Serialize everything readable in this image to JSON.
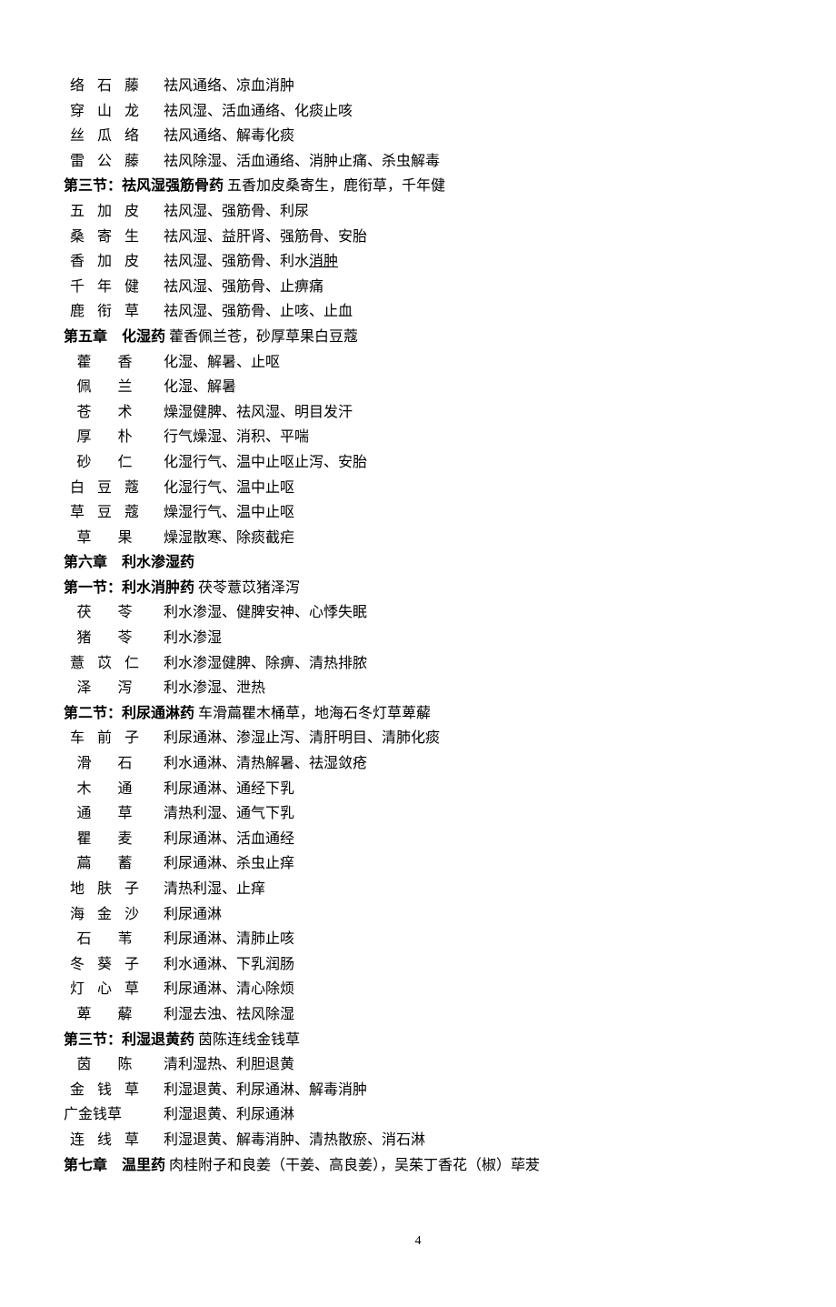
{
  "rows": [
    {
      "type": "item",
      "name": "络石藤",
      "desc": "祛风通络、凉血消肿"
    },
    {
      "type": "item",
      "name": "穿山龙",
      "desc": "祛风湿、活血通络、化痰止咳"
    },
    {
      "type": "item",
      "name": "丝瓜络",
      "desc": "祛风通络、解毒化痰"
    },
    {
      "type": "item",
      "name": "雷公藤",
      "desc": "祛风除湿、活血通络、消肿止痛、杀虫解毒"
    },
    {
      "type": "hdr",
      "bold": "第三节：祛风湿强筋骨药",
      "rest": " 五香加皮桑寄生，鹿衔草，千年健"
    },
    {
      "type": "item",
      "name": "五加皮",
      "desc": "祛风湿、强筋骨、利尿"
    },
    {
      "type": "item",
      "name": "桑寄生",
      "desc": "祛风湿、益肝肾、强筋骨、安胎"
    },
    {
      "type": "item",
      "name": "香加皮",
      "desc_pre": "祛风湿、强筋骨、利水",
      "desc_u": "消肿"
    },
    {
      "type": "item",
      "name": "千年健",
      "desc": "祛风湿、强筋骨、止痹痛"
    },
    {
      "type": "item",
      "name": "鹿衔草",
      "desc": "祛风湿、强筋骨、止咳、止血"
    },
    {
      "type": "hdr",
      "bold": "第五章　化湿药",
      "rest": " 藿香佩兰苍，砂厚草果白豆蔻"
    },
    {
      "type": "item",
      "name": "藿香",
      "desc": "化湿、解暑、止呕"
    },
    {
      "type": "item",
      "name": "佩兰",
      "desc": "化湿、解暑"
    },
    {
      "type": "item",
      "name": "苍术",
      "desc": "燥湿健脾、祛风湿、明目发汗"
    },
    {
      "type": "item",
      "name": "厚朴",
      "desc": "行气燥湿、消积、平喘"
    },
    {
      "type": "item",
      "name": "砂仁",
      "desc": "化湿行气、温中止呕止泻、安胎"
    },
    {
      "type": "item",
      "name": "白豆蔻",
      "desc": "化湿行气、温中止呕"
    },
    {
      "type": "item",
      "name": "草豆蔻",
      "desc": "燥湿行气、温中止呕"
    },
    {
      "type": "item",
      "name": "草果",
      "desc": "燥湿散寒、除痰截疟"
    },
    {
      "type": "hdr",
      "bold": "第六章　利水渗湿药",
      "rest": ""
    },
    {
      "type": "hdr",
      "bold": "第一节：利水消肿药",
      "rest": " 茯苓薏苡猪泽泻"
    },
    {
      "type": "item",
      "name": "茯苓",
      "desc": "利水渗湿、健脾安神、心悸失眠"
    },
    {
      "type": "item",
      "name": "猪苓",
      "desc": "利水渗湿"
    },
    {
      "type": "item",
      "name": "薏苡仁",
      "desc": "利水渗湿健脾、除痹、清热排脓"
    },
    {
      "type": "item",
      "name": "泽泻",
      "desc": "利水渗湿、泄热"
    },
    {
      "type": "hdr",
      "bold": "第二节：利尿通淋药",
      "rest": " 车滑萹瞿木桶草，地海石冬灯草萆薢"
    },
    {
      "type": "item",
      "name": "车前子",
      "desc": "利尿通淋、渗湿止泻、清肝明目、清肺化痰"
    },
    {
      "type": "item",
      "name": "滑石",
      "desc": "利水通淋、清热解暑、祛湿敛疮"
    },
    {
      "type": "item",
      "name": "木通",
      "desc": "利尿通淋、通经下乳"
    },
    {
      "type": "item",
      "name": "通草",
      "desc": "清热利湿、通气下乳"
    },
    {
      "type": "item",
      "name": "瞿麦",
      "desc": "利尿通淋、活血通经"
    },
    {
      "type": "item",
      "name": "萹蓄",
      "desc": "利尿通淋、杀虫止痒"
    },
    {
      "type": "item",
      "name": "地肤子",
      "desc": "清热利湿、止痒"
    },
    {
      "type": "item",
      "name": "海金沙",
      "desc": "利尿通淋"
    },
    {
      "type": "item",
      "name": "石苇",
      "desc": "利尿通淋、清肺止咳"
    },
    {
      "type": "item",
      "name": "冬葵子",
      "desc": "利水通淋、下乳润肠"
    },
    {
      "type": "item",
      "name": "灯心草",
      "desc": "利尿通淋、清心除烦"
    },
    {
      "type": "item",
      "name": "萆薢",
      "desc": "利湿去浊、祛风除湿"
    },
    {
      "type": "hdr",
      "bold": "第三节：利湿退黄药",
      "rest": " 茵陈连线金钱草"
    },
    {
      "type": "item",
      "name": "茵陈",
      "desc": "清利湿热、利胆退黄"
    },
    {
      "type": "item",
      "name": "金钱草",
      "desc": "利湿退黄、利尿通淋、解毒消肿"
    },
    {
      "type": "item",
      "name": "广金钱草",
      "desc": "利湿退黄、利尿通淋"
    },
    {
      "type": "item",
      "name": "连线草",
      "desc": "利湿退黄、解毒消肿、清热散瘀、消石淋"
    },
    {
      "type": "hdr",
      "bold": "第七章　温里药",
      "rest": " 肉桂附子和良姜（干姜、高良姜），吴茱丁香花（椒）荜茇"
    }
  ],
  "page_number": "4"
}
